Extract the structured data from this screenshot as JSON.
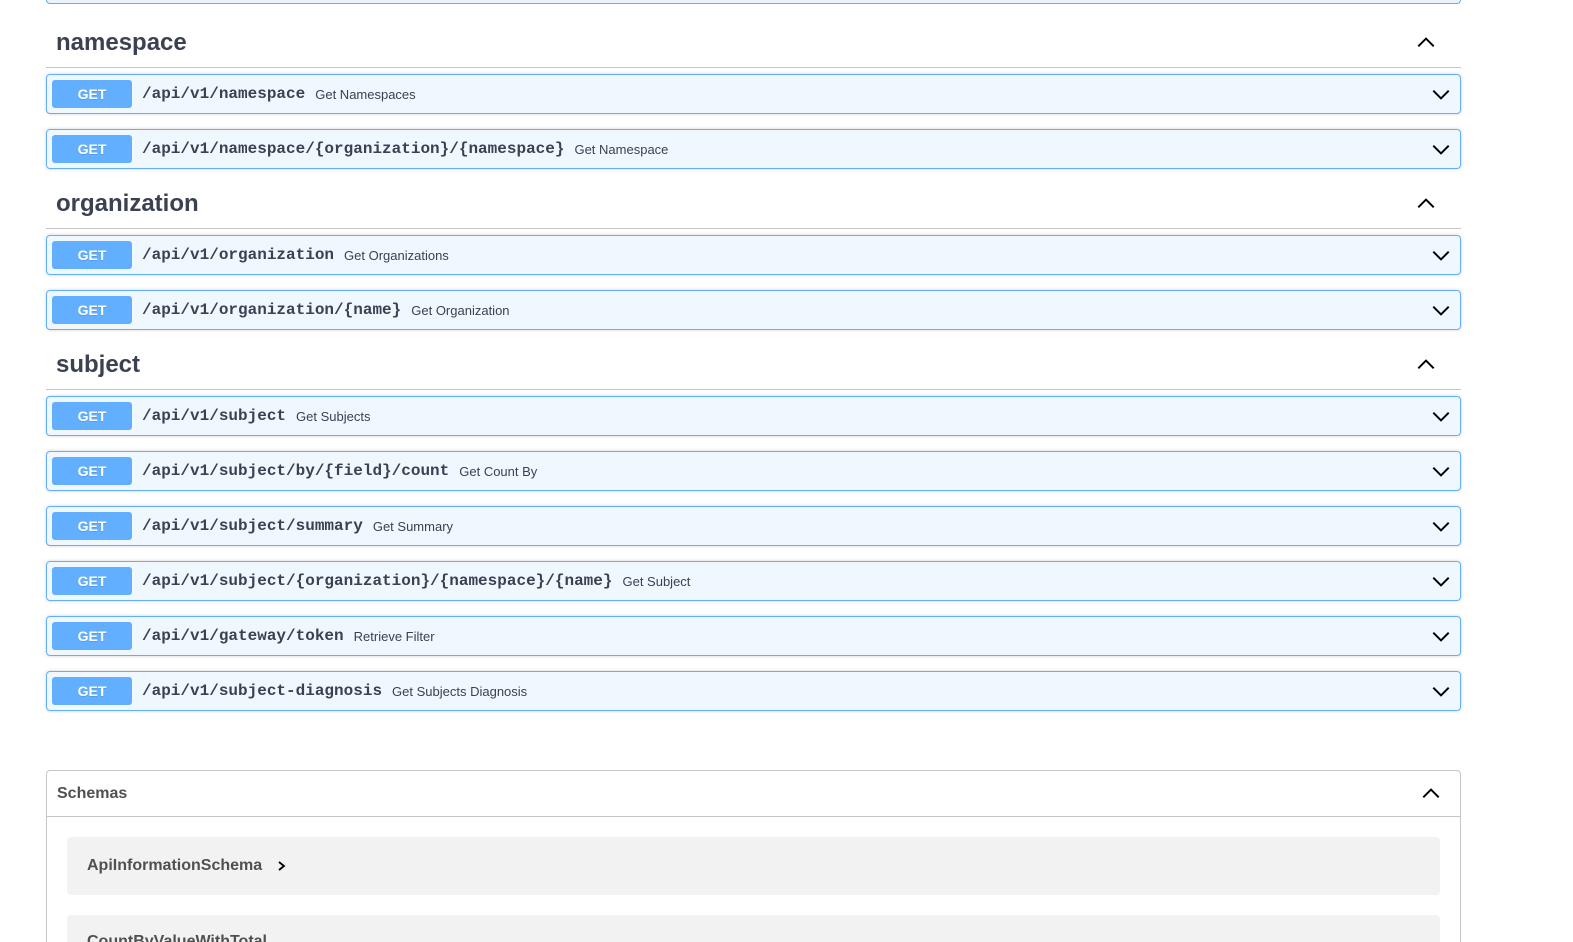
{
  "sections": [
    {
      "title": "namespace",
      "ops": [
        {
          "method": "GET",
          "path": "/api/v1/namespace",
          "summary": "Get Namespaces"
        },
        {
          "method": "GET",
          "path": "/api/v1/namespace/{organization}/{namespace}",
          "summary": "Get Namespace"
        }
      ]
    },
    {
      "title": "organization",
      "ops": [
        {
          "method": "GET",
          "path": "/api/v1/organization",
          "summary": "Get Organizations"
        },
        {
          "method": "GET",
          "path": "/api/v1/organization/{name}",
          "summary": "Get Organization"
        }
      ]
    },
    {
      "title": "subject",
      "ops": [
        {
          "method": "GET",
          "path": "/api/v1/subject",
          "summary": "Get Subjects"
        },
        {
          "method": "GET",
          "path": "/api/v1/subject/by/{field}/count",
          "summary": "Get Count By"
        },
        {
          "method": "GET",
          "path": "/api/v1/subject/summary",
          "summary": "Get Summary"
        },
        {
          "method": "GET",
          "path": "/api/v1/subject/{organization}/{namespace}/{name}",
          "summary": "Get Subject"
        },
        {
          "method": "GET",
          "path": "/api/v1/gateway/token",
          "summary": "Retrieve Filter"
        },
        {
          "method": "GET",
          "path": "/api/v1/subject-diagnosis",
          "summary": "Get Subjects Diagnosis"
        }
      ]
    }
  ],
  "schemas": {
    "title": "Schemas",
    "models": [
      "ApiInformationSchema",
      "CountByValueWithTotal"
    ]
  },
  "colors": {
    "get": "#61affe",
    "text": "#3b4151"
  },
  "icons": {
    "section_toggle": "chevron-up-icon",
    "op_toggle": "chevron-down-icon",
    "model_toggle": "chevron-right-icon"
  }
}
